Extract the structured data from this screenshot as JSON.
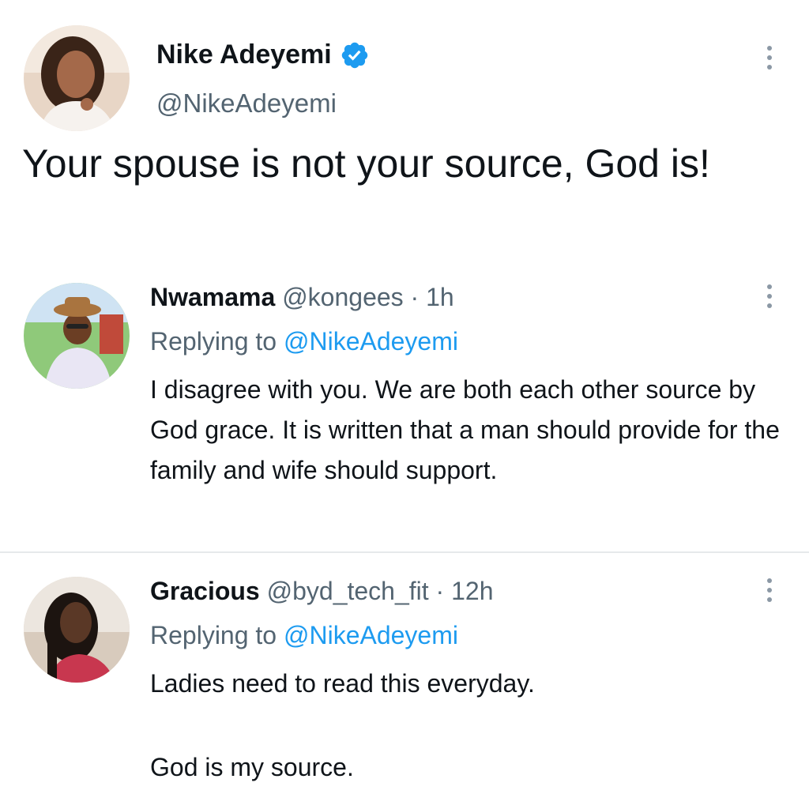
{
  "main_tweet": {
    "name": "Nike Adeyemi",
    "handle": "@NikeAdeyemi",
    "verified_icon": "verified-badge-icon",
    "text": "Your spouse is not your source, God is!"
  },
  "replies": [
    {
      "name": "Nwamama",
      "handle": "@kongees",
      "separator": "·",
      "time": "1h",
      "replying_prefix": "Replying to",
      "replying_to": "@NikeAdeyemi",
      "text": "I disagree with you. We are both each other source by God grace. It is written that a man should provide for the family and wife should support."
    },
    {
      "name": "Gracious",
      "handle": "@byd_tech_fit",
      "separator": "·",
      "time": "12h",
      "replying_prefix": "Replying to",
      "replying_to": "@NikeAdeyemi",
      "text_line1": "Ladies need to read this everyday.",
      "text_line2": "God is my source."
    }
  ],
  "colors": {
    "primary_text": "#0f1419",
    "secondary_text": "#536471",
    "mention": "#1d9bf0",
    "verified": "#1d9bf0",
    "divider": "#e6e9eb"
  }
}
